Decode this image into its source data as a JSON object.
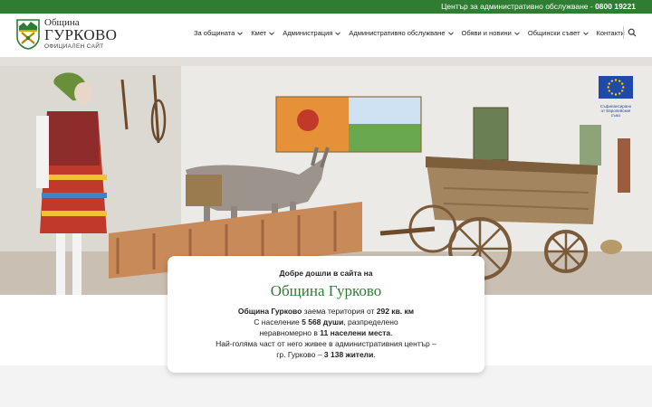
{
  "topbar": {
    "label": "Център за административно обслужване - ",
    "phone": "0800 19221"
  },
  "brand": {
    "line1": "Община",
    "line2": "ГУРКОВО",
    "line3": "ОФИЦИАЛЕН САЙТ"
  },
  "nav": {
    "items": [
      {
        "label": "За общината",
        "dropdown": true
      },
      {
        "label": "Кмет",
        "dropdown": true
      },
      {
        "label": "Администрация",
        "dropdown": true
      },
      {
        "label": "Административно обслужване",
        "dropdown": true
      },
      {
        "label": "Обяви и новини",
        "dropdown": true
      },
      {
        "label": "Общински съвет",
        "dropdown": true
      },
      {
        "label": "Контакти",
        "dropdown": false
      }
    ],
    "search_icon": "search-icon"
  },
  "eu_badge": {
    "text": "Съфинансирано от Европейския съюз"
  },
  "welcome": {
    "heading": "Добре дошли в сайта на",
    "title": "Община Гурково",
    "line1": [
      "Община Гурково",
      " заема територия от ",
      "292 кв. км"
    ],
    "line2": [
      "С население ",
      "5 568 души",
      ", разпределено"
    ],
    "line3": [
      "неравномерно в ",
      "11 населени места",
      "."
    ],
    "line4": "Най-голяма част от него живее в административния център –",
    "line5": [
      "гр. Гурково – ",
      "3 138 жители",
      "."
    ]
  },
  "colors": {
    "accent": "#2e7d32",
    "eu_blue": "#1f4aa8",
    "eu_gold": "#ffcc00"
  }
}
